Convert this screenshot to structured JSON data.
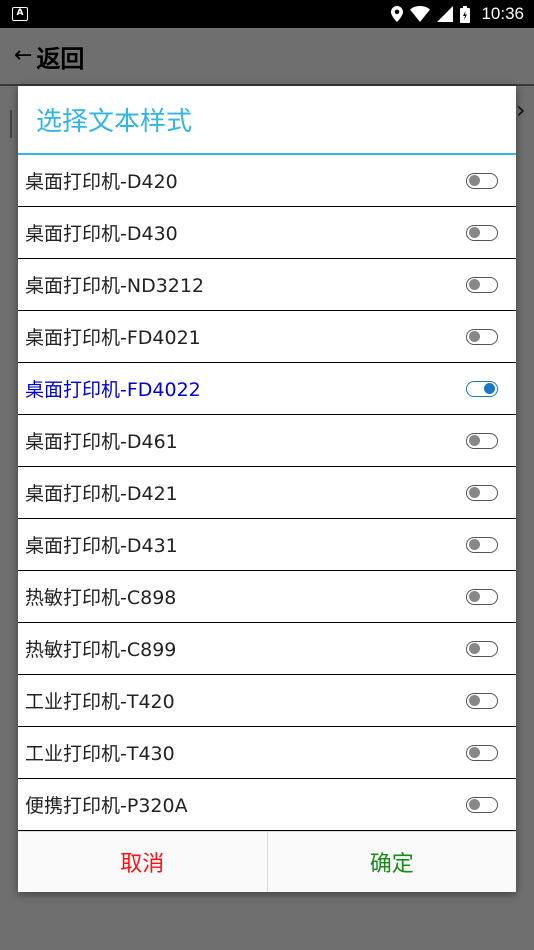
{
  "status_bar": {
    "time": "10:36",
    "app_icon_glyph": "A",
    "icons": [
      "location-icon",
      "wifi-icon",
      "signal-icon",
      "battery-icon"
    ]
  },
  "app_bar": {
    "back_label": "返回",
    "back_icon": "arrow-left-icon"
  },
  "dialog": {
    "title": "选择文本样式",
    "accent_color": "#33b5e5",
    "selected_color": "#0000d0",
    "options": [
      {
        "label": "桌面打印机-D420",
        "on": false
      },
      {
        "label": "桌面打印机-D430",
        "on": false
      },
      {
        "label": "桌面打印机-ND3212",
        "on": false
      },
      {
        "label": "桌面打印机-FD4021",
        "on": false
      },
      {
        "label": "桌面打印机-FD4022",
        "on": true
      },
      {
        "label": "桌面打印机-D461",
        "on": false
      },
      {
        "label": "桌面打印机-D421",
        "on": false
      },
      {
        "label": "桌面打印机-D431",
        "on": false
      },
      {
        "label": "热敏打印机-C898",
        "on": false
      },
      {
        "label": "热敏打印机-C899",
        "on": false
      },
      {
        "label": "工业打印机-T420",
        "on": false
      },
      {
        "label": "工业打印机-T430",
        "on": false
      },
      {
        "label": "便携打印机-P320A",
        "on": false
      }
    ],
    "cancel_label": "取消",
    "cancel_color": "#ff1010",
    "confirm_label": "确定",
    "confirm_color": "#1a8a1a"
  }
}
